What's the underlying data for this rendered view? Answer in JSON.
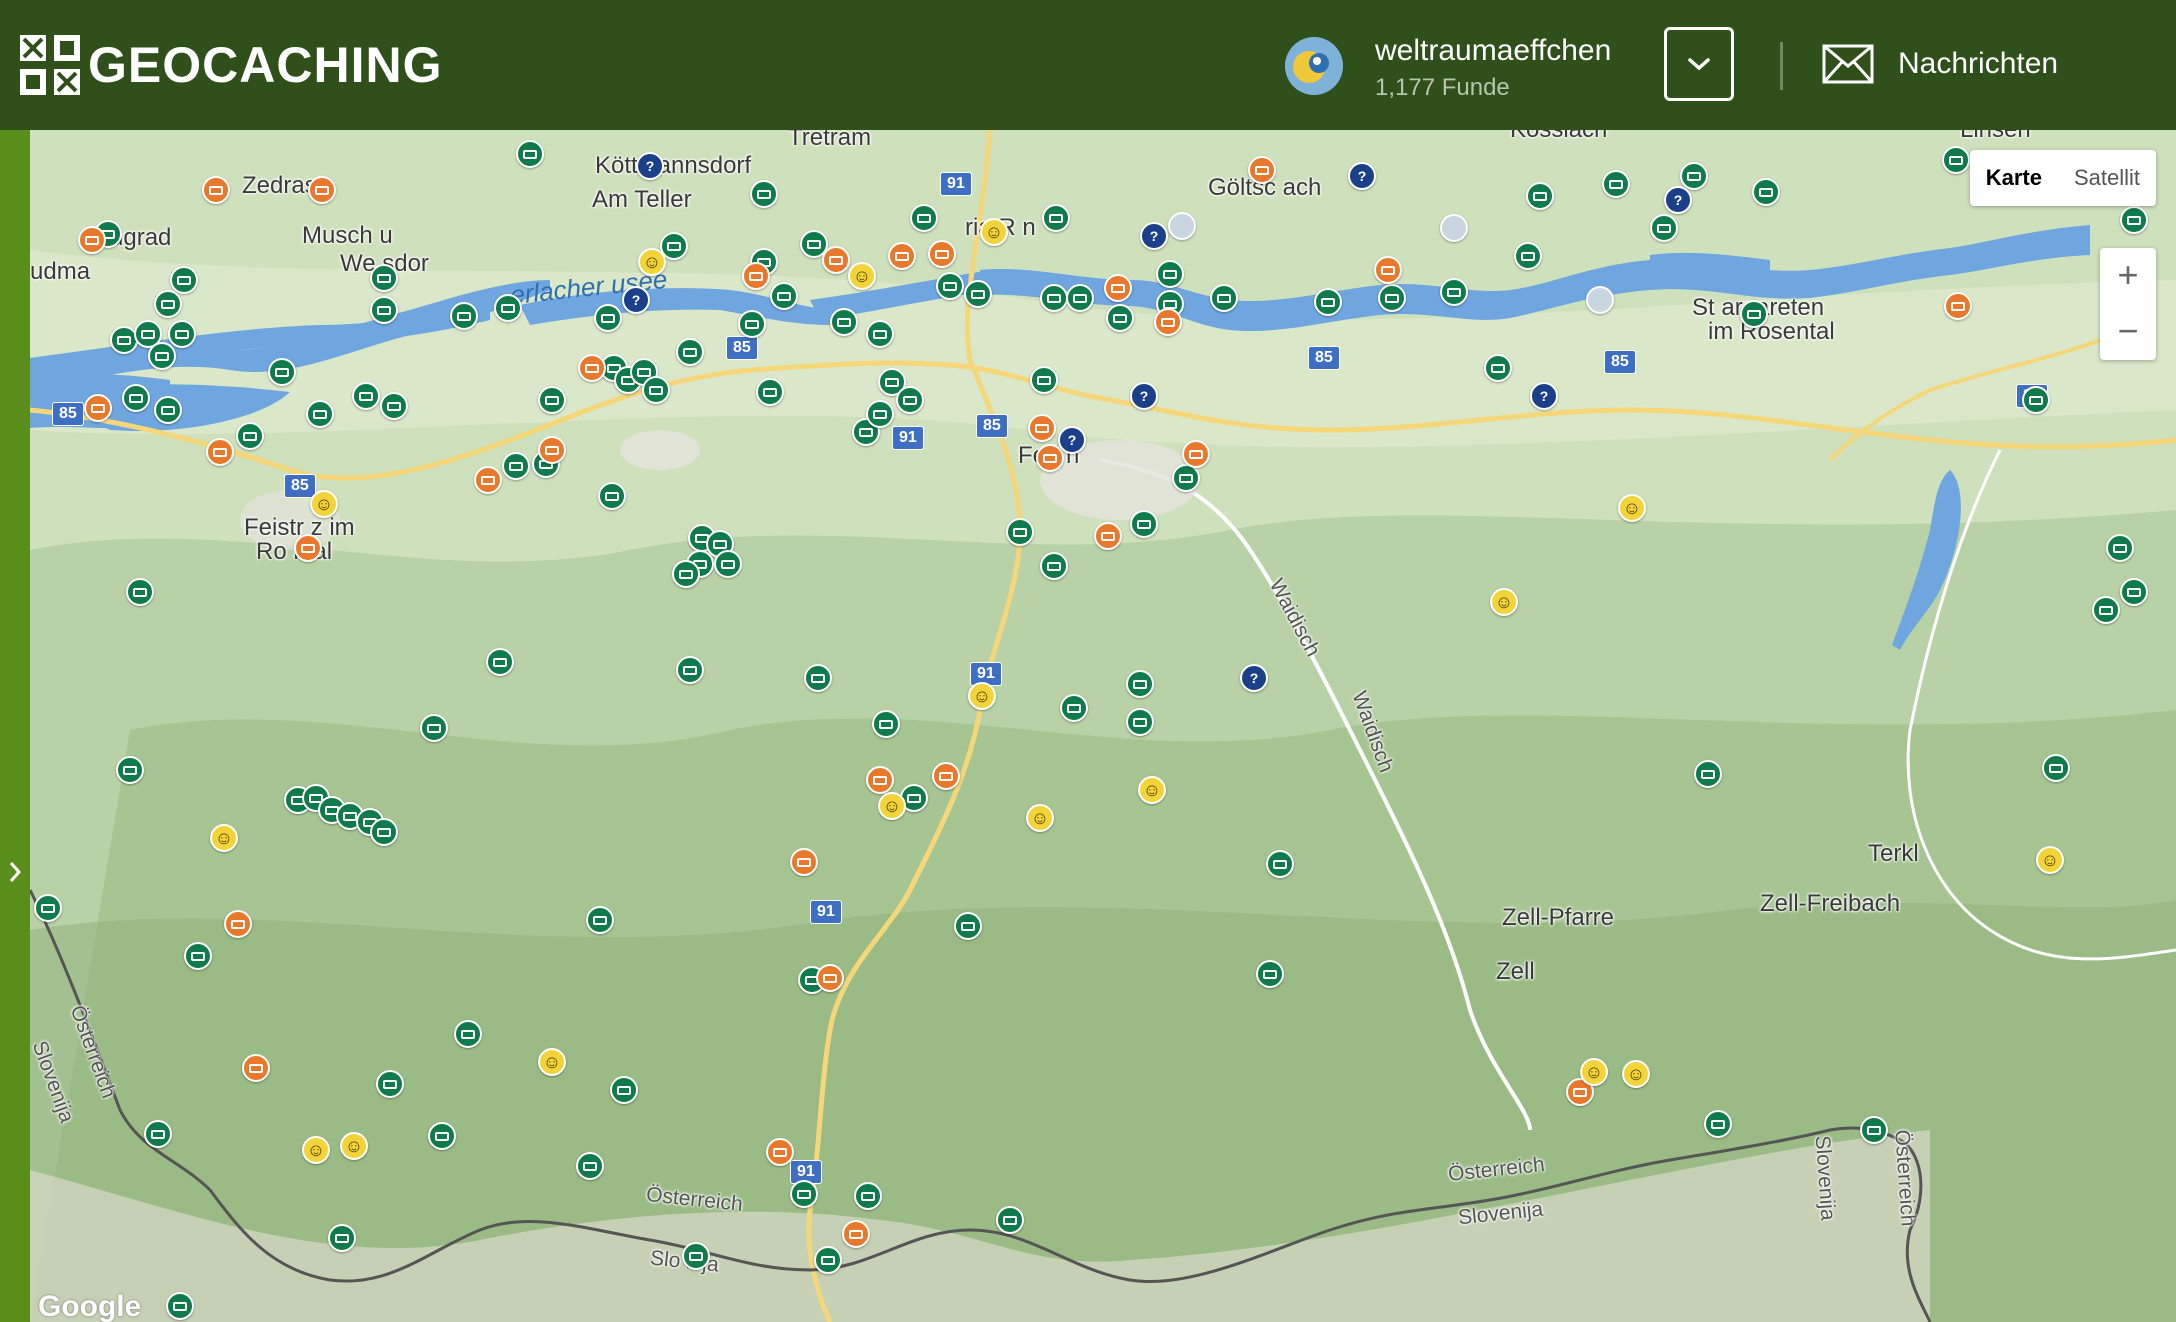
{
  "header": {
    "logo_text": "GEOCACHING",
    "username": "weltraumaeffchen",
    "finds": "1,177 Funde",
    "messages_label": "Nachrichten"
  },
  "colors": {
    "header": "#2f4f1b",
    "rail": "#5a8e1a",
    "traditional": "#0f7a4c",
    "multi": "#e8792c",
    "mystery": "#1c3f8a"
  },
  "map": {
    "layer_options": [
      "Karte",
      "Satellit"
    ],
    "selected_layer": "Karte",
    "zoom_in": "+",
    "zoom_out": "−",
    "attribution": "Google",
    "labels": {
      "tretram": "Tretram",
      "koettmannsdorf": "Köttmannsdorf",
      "am_teller": "Am Teller",
      "zedras": "Zedras",
      "augrad": "ugrad",
      "muschitz": "Musch u",
      "weizelsdorf": "We sdor",
      "ludma": "udma",
      "ferlacher_stausee": "erlacher  usee",
      "maria_rain": "ria R n",
      "goltschach": "Göltsc ach",
      "russach": "Kossiach",
      "linsenberg": "Linsen",
      "st_margareten": "St  argareten",
      "im_rosental_east": "im Rosental",
      "feistritz": "Feistr z im",
      "rosental": "Ro ntal",
      "ferlach": "Ferl  n",
      "waidisch1": "Waidisch",
      "waidisch2": "Waidisch",
      "terkl": "Terkl",
      "zell_freibach": "Zell-Freibach",
      "zell_pfarre": "Zell-Pfarre",
      "zell": "Zell",
      "osterreich_w": "Österreich",
      "slovenija_w": "Slovenija",
      "osterreich_s": "Österreich",
      "slovenija_s": "Slo  nija",
      "osterreich_se": "Österreich",
      "slovenija_se": "Slovenija",
      "slovenija_e": "Slovenija",
      "osterreich_e": "Österreich"
    },
    "road_shields": [
      "85",
      "85",
      "85",
      "85",
      "85",
      "91",
      "91",
      "91",
      "91",
      "91",
      "85",
      "85"
    ]
  }
}
